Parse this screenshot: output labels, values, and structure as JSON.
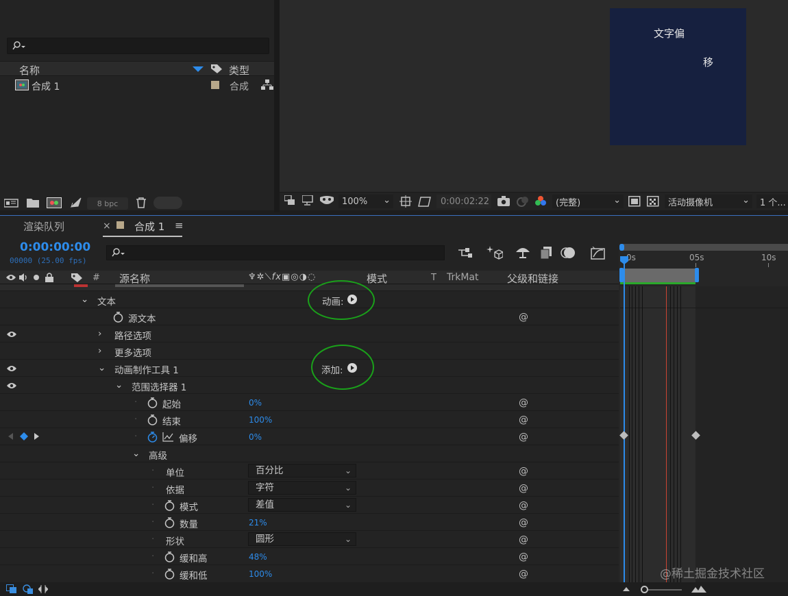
{
  "project": {
    "col_name": "名称",
    "col_type": "类型",
    "item_name": "合成 1",
    "item_type": "合成",
    "bpc": "8 bpc"
  },
  "viewer": {
    "comp_text_1": "文字偏",
    "comp_text_2": "移",
    "zoom": "100%",
    "timecode": "0:00:02:22",
    "quality": "(完整)",
    "camera": "活动摄像机",
    "views": "1 个..."
  },
  "tabs": {
    "render_queue": "渲染队列",
    "comp": "合成 1",
    "menu": "≡",
    "close": "×"
  },
  "timeline": {
    "current_time": "0:00:00:00",
    "frame_info": "00000 (25.00 fps)",
    "columns": {
      "hash": "#",
      "source_name": "源名称",
      "mode": "模式",
      "t": "T",
      "trkmat": "TrkMat",
      "parent": "父级和链接"
    },
    "ruler": [
      "0s",
      "05s",
      "10s"
    ],
    "rows": [
      {
        "label": "文本",
        "extra": "动画:"
      },
      {
        "label": "源文本"
      },
      {
        "label": "路径选项"
      },
      {
        "label": "更多选项"
      },
      {
        "label": "动画制作工具 1",
        "extra": "添加:"
      },
      {
        "label": "范围选择器 1"
      },
      {
        "label": "起始",
        "value": "0%"
      },
      {
        "label": "结束",
        "value": "100%"
      },
      {
        "label": "偏移",
        "value": "0%"
      },
      {
        "label": "高级"
      },
      {
        "label": "单位",
        "dropdown": "百分比"
      },
      {
        "label": "依据",
        "dropdown": "字符"
      },
      {
        "label": "模式",
        "dropdown": "差值"
      },
      {
        "label": "数量",
        "value": "21%"
      },
      {
        "label": "形状",
        "dropdown": "圆形"
      },
      {
        "label": "缓和高",
        "value": "48%"
      },
      {
        "label": "缓和低",
        "value": "100%"
      }
    ]
  },
  "watermark": "@稀土掘金技术社区"
}
